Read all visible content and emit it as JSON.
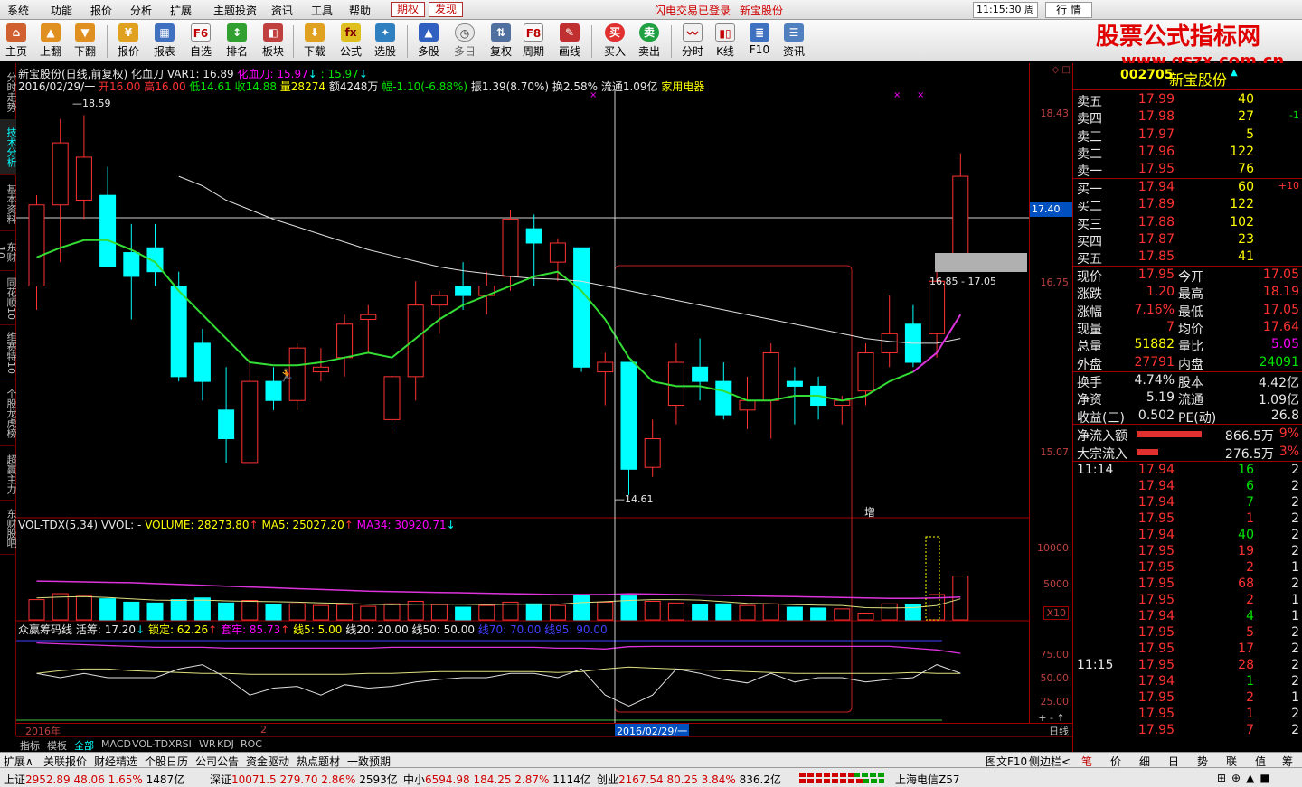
{
  "menu": {
    "items": [
      "系统",
      "功能",
      "报价",
      "分析",
      "扩展",
      "主题投资",
      "资讯",
      "工具",
      "帮助"
    ],
    "tag_qiquan": "期权",
    "tag_faxian": "发现",
    "login_status": "闪电交易已登录",
    "stock_title": "新宝股份",
    "clock": "11:15:30 周五",
    "mode_button": "行 情"
  },
  "toolbar": {
    "buttons": [
      "主页",
      "上翻",
      "下翻",
      "报价",
      "报表",
      "自选",
      "排名",
      "板块",
      "下载",
      "公式",
      "选股",
      "多股",
      "多日",
      "复权",
      "周期",
      "画线",
      "买入",
      "卖出",
      "分时",
      "K线",
      "F10",
      "资讯"
    ],
    "f6_icon": "F6",
    "f8_icon": "F8"
  },
  "watermark": {
    "title": "股票公式指标网",
    "url": "www.gszx.com.cn"
  },
  "left_tabs": [
    "分时走势",
    "技术分析",
    "基本资料",
    "东财10",
    "同花顺10",
    "维赛特10",
    "个股龙虎榜",
    "超赢主力",
    "东财股吧"
  ],
  "chart_header": {
    "line1_name": "新宝股份(日线,前复权) 化血刀",
    "line1_var": "VAR1: 16.89",
    "line1_hxd": "化血刀: 15.97",
    "line1_v3": ": 15.97",
    "line2_date": "2016/02/29/一",
    "line2_open": "开16.00",
    "line2_high": "高16.00",
    "line2_low": "低14.61",
    "line2_close": "收14.88",
    "line2_vol": "量28274",
    "line2_amt": "额4248万",
    "line2_chg": "幅-1.10(-6.88%)",
    "line2_rest": "振1.39(8.70%) 换2.58% 流通1.09亿",
    "line2_sector": "家用电器"
  },
  "main_annotations": {
    "high_label": "18.59",
    "low_label": "14.61",
    "range_label": "16.85 - 17.05",
    "zeng_label": "增",
    "crosshair_price": "17.40"
  },
  "vol_header": {
    "name": "VOL-TDX(5,34) VVOL: -",
    "volume": "VOLUME: 28273.80",
    "ma5": "MA5: 25027.20",
    "ma34": "MA34: 30920.71"
  },
  "chip_header": {
    "name": "众赢筹码线",
    "huochou": "活筹: 17.20",
    "suoding": "锁定: 62.26",
    "taolao": "套牢: 85.73",
    "x5": "线5: 5.00",
    "x20": "线20: 20.00",
    "x50": "线50: 50.00",
    "x70": "线70: 70.00",
    "x95": "线95: 90.00"
  },
  "price_axis": [
    "18.43",
    "16.75",
    "15.07"
  ],
  "vol_axis": [
    "10000",
    "5000",
    "X10"
  ],
  "chip_axis": [
    "75.00",
    "50.00",
    "25.00"
  ],
  "date_axis": {
    "year": "2016年",
    "month": "2",
    "cursor": "2016/02/29/一",
    "period": "日线"
  },
  "chart_tabs": [
    "指标",
    "模板",
    "全部",
    "MACD",
    "VOL-TDX",
    "RSI",
    "WR",
    "KDJ",
    "ROC"
  ],
  "func_tabs": [
    "扩展∧",
    "关联报价",
    "财经精选",
    "个股日历",
    "公司公告",
    "资金驱动",
    "热点题材",
    "一致预期"
  ],
  "func_right": [
    "图文F10",
    "侧边栏<"
  ],
  "status_bar": {
    "sh_name": "上证",
    "sh_val": "2952.89",
    "sh_chg": "48.06",
    "sh_pct": "1.65%",
    "sh_amt": "1487亿",
    "sz_name": "深证",
    "sz_val": "10071.5",
    "sz_chg": "279.70",
    "sz_pct": "2.86%",
    "sz_amt": "2593亿",
    "zx_name": "中小",
    "zx_val": "6594.98",
    "zx_chg": "184.25",
    "zx_pct": "2.87%",
    "zx_amt": "1114亿",
    "cy_name": "创业",
    "cy_val": "2167.54",
    "cy_chg": "80.25",
    "cy_pct": "3.84%",
    "cy_amt": "836.2亿",
    "server": "上海电信Z57"
  },
  "quote": {
    "code": "002705",
    "name": "新宝股份",
    "asks": [
      {
        "label": "卖五",
        "price": "17.99",
        "vol": "40",
        "chg": ""
      },
      {
        "label": "卖四",
        "price": "17.98",
        "vol": "27",
        "chg": "-1"
      },
      {
        "label": "卖三",
        "price": "17.97",
        "vol": "5",
        "chg": ""
      },
      {
        "label": "卖二",
        "price": "17.96",
        "vol": "122",
        "chg": ""
      },
      {
        "label": "卖一",
        "price": "17.95",
        "vol": "76",
        "chg": ""
      }
    ],
    "bids": [
      {
        "label": "买一",
        "price": "17.94",
        "vol": "60",
        "chg": "+10"
      },
      {
        "label": "买二",
        "price": "17.89",
        "vol": "122",
        "chg": ""
      },
      {
        "label": "买三",
        "price": "17.88",
        "vol": "102",
        "chg": ""
      },
      {
        "label": "买四",
        "price": "17.87",
        "vol": "23",
        "chg": ""
      },
      {
        "label": "买五",
        "price": "17.85",
        "vol": "41",
        "chg": ""
      }
    ],
    "stats": [
      {
        "l1": "现价",
        "v1": "17.95",
        "l2": "今开",
        "v2": "17.05"
      },
      {
        "l1": "涨跌",
        "v1": "1.20",
        "l2": "最高",
        "v2": "18.19"
      },
      {
        "l1": "涨幅",
        "v1": "7.16%",
        "l2": "最低",
        "v2": "17.05"
      },
      {
        "l1": "现量",
        "v1": "7",
        "l2": "均价",
        "v2": "17.64"
      },
      {
        "l1": "总量",
        "v1": "51882",
        "l2": "量比",
        "v2": "5.05"
      },
      {
        "l1": "外盘",
        "v1": "27791",
        "l2": "内盘",
        "v2": "24091"
      }
    ],
    "stats2": [
      {
        "l1": "换手",
        "v1": "4.74%",
        "l2": "股本",
        "v2": "4.42亿"
      },
      {
        "l1": "净资",
        "v1": "5.19",
        "l2": "流通",
        "v2": "1.09亿"
      },
      {
        "l1": "收益(三)",
        "v1": "0.502",
        "l2": "PE(动)",
        "v2": "26.8"
      }
    ],
    "flows": [
      {
        "label": "净流入额",
        "value": "866.5万",
        "pct": "9%",
        "bar": 0.9
      },
      {
        "label": "大宗流入",
        "value": "276.5万",
        "pct": "3%",
        "bar": 0.3
      }
    ],
    "ticks": [
      {
        "time": "11:14",
        "price": "17.94",
        "vol": "16",
        "n": "2",
        "dir": "g"
      },
      {
        "time": "",
        "price": "17.94",
        "vol": "6",
        "n": "2",
        "dir": "g"
      },
      {
        "time": "",
        "price": "17.94",
        "vol": "7",
        "n": "2",
        "dir": "g"
      },
      {
        "time": "",
        "price": "17.95",
        "vol": "1",
        "n": "2",
        "dir": "r"
      },
      {
        "time": "",
        "price": "17.94",
        "vol": "40",
        "n": "2",
        "dir": "g"
      },
      {
        "time": "",
        "price": "17.95",
        "vol": "19",
        "n": "2",
        "dir": "r"
      },
      {
        "time": "",
        "price": "17.95",
        "vol": "2",
        "n": "1",
        "dir": "r"
      },
      {
        "time": "",
        "price": "17.95",
        "vol": "68",
        "n": "2",
        "dir": "r"
      },
      {
        "time": "",
        "price": "17.95",
        "vol": "2",
        "n": "1",
        "dir": "r"
      },
      {
        "time": "",
        "price": "17.94",
        "vol": "4",
        "n": "1",
        "dir": "g"
      },
      {
        "time": "",
        "price": "17.95",
        "vol": "5",
        "n": "2",
        "dir": "r"
      },
      {
        "time": "",
        "price": "17.95",
        "vol": "17",
        "n": "2",
        "dir": "r"
      },
      {
        "time": "11:15",
        "price": "17.95",
        "vol": "28",
        "n": "2",
        "dir": "r"
      },
      {
        "time": "",
        "price": "17.94",
        "vol": "1",
        "n": "2",
        "dir": "g"
      },
      {
        "time": "",
        "price": "17.95",
        "vol": "2",
        "n": "1",
        "dir": "r"
      },
      {
        "time": "",
        "price": "17.95",
        "vol": "1",
        "n": "2",
        "dir": "r"
      },
      {
        "time": "",
        "price": "17.95",
        "vol": "7",
        "n": "2",
        "dir": "r"
      }
    ],
    "bottom_tabs": [
      "笔",
      "价",
      "细",
      "日",
      "势",
      "联",
      "值",
      "筹"
    ]
  },
  "colors": {
    "up": "#ff3232",
    "down": "#00ffff",
    "ma_green": "#33dd33",
    "ma_white": "#e0e0e0",
    "bg": "#000000"
  },
  "chart_data": {
    "type": "candlestick",
    "ylim": [
      14.4,
      18.85
    ],
    "candles": [
      {
        "o": 16.8,
        "h": 17.75,
        "l": 16.55,
        "c": 17.65
      },
      {
        "o": 17.65,
        "h": 18.55,
        "l": 17.05,
        "c": 18.3
      },
      {
        "o": 17.7,
        "h": 18.59,
        "l": 17.5,
        "c": 18.15
      },
      {
        "o": 17.75,
        "h": 18.05,
        "l": 17.2,
        "c": 17.0
      },
      {
        "o": 17.15,
        "h": 17.45,
        "l": 16.45,
        "c": 16.9
      },
      {
        "o": 17.2,
        "h": 17.45,
        "l": 16.8,
        "c": 16.95
      },
      {
        "o": 16.8,
        "h": 16.95,
        "l": 15.8,
        "c": 15.85
      },
      {
        "o": 16.2,
        "h": 16.35,
        "l": 15.6,
        "c": 15.8
      },
      {
        "o": 15.5,
        "h": 15.95,
        "l": 14.95,
        "c": 15.2
      },
      {
        "o": 14.95,
        "h": 16.05,
        "l": 14.95,
        "c": 15.8
      },
      {
        "o": 15.8,
        "h": 15.95,
        "l": 15.5,
        "c": 15.6
      },
      {
        "o": 15.6,
        "h": 16.2,
        "l": 15.5,
        "c": 16.15
      },
      {
        "o": 15.9,
        "h": 16.15,
        "l": 15.8,
        "c": 15.95
      },
      {
        "o": 16.05,
        "h": 16.5,
        "l": 15.85,
        "c": 16.4
      },
      {
        "o": 16.45,
        "h": 16.6,
        "l": 16.1,
        "c": 16.5
      },
      {
        "o": 15.4,
        "h": 16.15,
        "l": 15.3,
        "c": 15.85
      },
      {
        "o": 15.85,
        "h": 16.85,
        "l": 15.6,
        "c": 16.6
      },
      {
        "o": 16.6,
        "h": 16.75,
        "l": 16.3,
        "c": 16.7
      },
      {
        "o": 16.8,
        "h": 17.05,
        "l": 16.55,
        "c": 16.7
      },
      {
        "o": 16.7,
        "h": 16.95,
        "l": 16.5,
        "c": 16.8
      },
      {
        "o": 16.9,
        "h": 17.6,
        "l": 16.75,
        "c": 17.5
      },
      {
        "o": 17.4,
        "h": 17.55,
        "l": 16.8,
        "c": 17.25
      },
      {
        "o": 17.05,
        "h": 17.3,
        "l": 16.85,
        "c": 17.25
      },
      {
        "o": 17.2,
        "h": 17.2,
        "l": 15.9,
        "c": 15.95
      },
      {
        "o": 15.9,
        "h": 16.1,
        "l": 15.55,
        "c": 16.0
      },
      {
        "o": 16.0,
        "h": 16.0,
        "l": 14.61,
        "c": 14.88
      },
      {
        "o": 14.9,
        "h": 15.4,
        "l": 14.8,
        "c": 15.2
      },
      {
        "o": 15.55,
        "h": 16.2,
        "l": 15.35,
        "c": 16.0
      },
      {
        "o": 15.95,
        "h": 16.25,
        "l": 15.6,
        "c": 15.8
      },
      {
        "o": 15.8,
        "h": 16.0,
        "l": 15.4,
        "c": 15.45
      },
      {
        "o": 15.5,
        "h": 15.85,
        "l": 15.3,
        "c": 15.6
      },
      {
        "o": 15.6,
        "h": 16.2,
        "l": 15.2,
        "c": 16.1
      },
      {
        "o": 15.8,
        "h": 15.95,
        "l": 15.35,
        "c": 15.75
      },
      {
        "o": 15.75,
        "h": 15.85,
        "l": 15.4,
        "c": 15.55
      },
      {
        "o": 15.55,
        "h": 15.65,
        "l": 15.35,
        "c": 15.6
      },
      {
        "o": 15.7,
        "h": 16.2,
        "l": 15.55,
        "c": 16.1
      },
      {
        "o": 16.1,
        "h": 16.7,
        "l": 15.95,
        "c": 16.3
      },
      {
        "o": 16.4,
        "h": 16.6,
        "l": 15.95,
        "c": 16.0
      },
      {
        "o": 16.3,
        "h": 16.95,
        "l": 16.05,
        "c": 16.85
      },
      {
        "o": 17.05,
        "h": 18.19,
        "l": 17.05,
        "c": 17.95
      }
    ],
    "ma_green": [
      17.1,
      17.2,
      17.28,
      17.28,
      17.18,
      17.05,
      16.75,
      16.5,
      16.25,
      16.0,
      15.97,
      15.97,
      16.0,
      16.05,
      16.1,
      16.05,
      16.25,
      16.45,
      16.6,
      16.7,
      16.8,
      16.9,
      16.95,
      16.75,
      16.45,
      16.05,
      15.8,
      15.75,
      15.75,
      15.7,
      15.6,
      15.6,
      15.65,
      15.65,
      15.6,
      15.65,
      15.8,
      15.9,
      16.1,
      16.5
    ],
    "ma_white": [
      null,
      null,
      null,
      null,
      null,
      null,
      17.95,
      17.85,
      17.7,
      17.6,
      17.5,
      17.42,
      17.34,
      17.26,
      17.18,
      17.12,
      17.06,
      17.0,
      16.96,
      16.93,
      16.9,
      16.88,
      16.87,
      16.85,
      16.8,
      16.75,
      16.7,
      16.65,
      16.6,
      16.55,
      16.5,
      16.45,
      16.4,
      16.35,
      16.3,
      16.25,
      16.22,
      16.2,
      16.2,
      16.25
    ],
    "volumes": [
      24000,
      31000,
      28000,
      25000,
      21000,
      20000,
      24000,
      26000,
      20000,
      23000,
      18000,
      19000,
      17000,
      18000,
      16000,
      19000,
      22000,
      18000,
      15000,
      17000,
      21000,
      19000,
      17000,
      30000,
      21000,
      28274,
      22000,
      20000,
      18000,
      19000,
      17000,
      19000,
      15000,
      14000,
      13000,
      8000,
      19000,
      18000,
      30000,
      51882
    ],
    "vol_ylim": [
      0,
      120000
    ],
    "vol_ma5_white": [
      26000,
      27000,
      27500,
      26500,
      25000,
      23500,
      23000,
      23500,
      22500,
      22000,
      21500,
      21000,
      20000,
      19500,
      18500,
      18000,
      18500,
      18500,
      18500,
      18000,
      18500,
      18500,
      18500,
      20500,
      21500,
      23000,
      24000,
      24000,
      23500,
      21500,
      19500,
      19000,
      18000,
      17500,
      17000,
      14500,
      14000,
      14500,
      17000,
      25000
    ],
    "vol_ma34_magenta": [
      46000,
      45500,
      45000,
      44500,
      44000,
      43000,
      42000,
      41000,
      40000,
      39000,
      38000,
      37000,
      36000,
      35000,
      34000,
      33500,
      33000,
      32500,
      32000,
      31500,
      31000,
      30500,
      30000,
      30000,
      30000,
      30920,
      30500,
      30000,
      29500,
      29000,
      28500,
      28000,
      27500,
      27000,
      26500,
      26000,
      25500,
      25500,
      26000,
      27000
    ],
    "chip_magenta": [
      90,
      89,
      88,
      87,
      86,
      85,
      85,
      85,
      84,
      84,
      84,
      84,
      84,
      84,
      84,
      85,
      85,
      85,
      85,
      85,
      85,
      85,
      84,
      84,
      83,
      85.73,
      86,
      86,
      86,
      86,
      86,
      86,
      86,
      86,
      86,
      86,
      86,
      84,
      82,
      78
    ],
    "chip_yellow": [
      55,
      58,
      60,
      60,
      58,
      57,
      56,
      55,
      55,
      54,
      54,
      54,
      54,
      54,
      55,
      55,
      56,
      57,
      57,
      57,
      57,
      57,
      56,
      57,
      60,
      62.26,
      61,
      60,
      59,
      58,
      57,
      56,
      55,
      55,
      55,
      55,
      55,
      56,
      55,
      55
    ],
    "chip_white": [
      55,
      50,
      55,
      50,
      50,
      50,
      60,
      65,
      50,
      30,
      38,
      40,
      30,
      42,
      38,
      40,
      45,
      48,
      50,
      50,
      55,
      55,
      50,
      60,
      30,
      17.2,
      30,
      60,
      55,
      48,
      44,
      55,
      45,
      50,
      50,
      45,
      48,
      50,
      65,
      55
    ],
    "chip_ylim": [
      0,
      100
    ]
  }
}
